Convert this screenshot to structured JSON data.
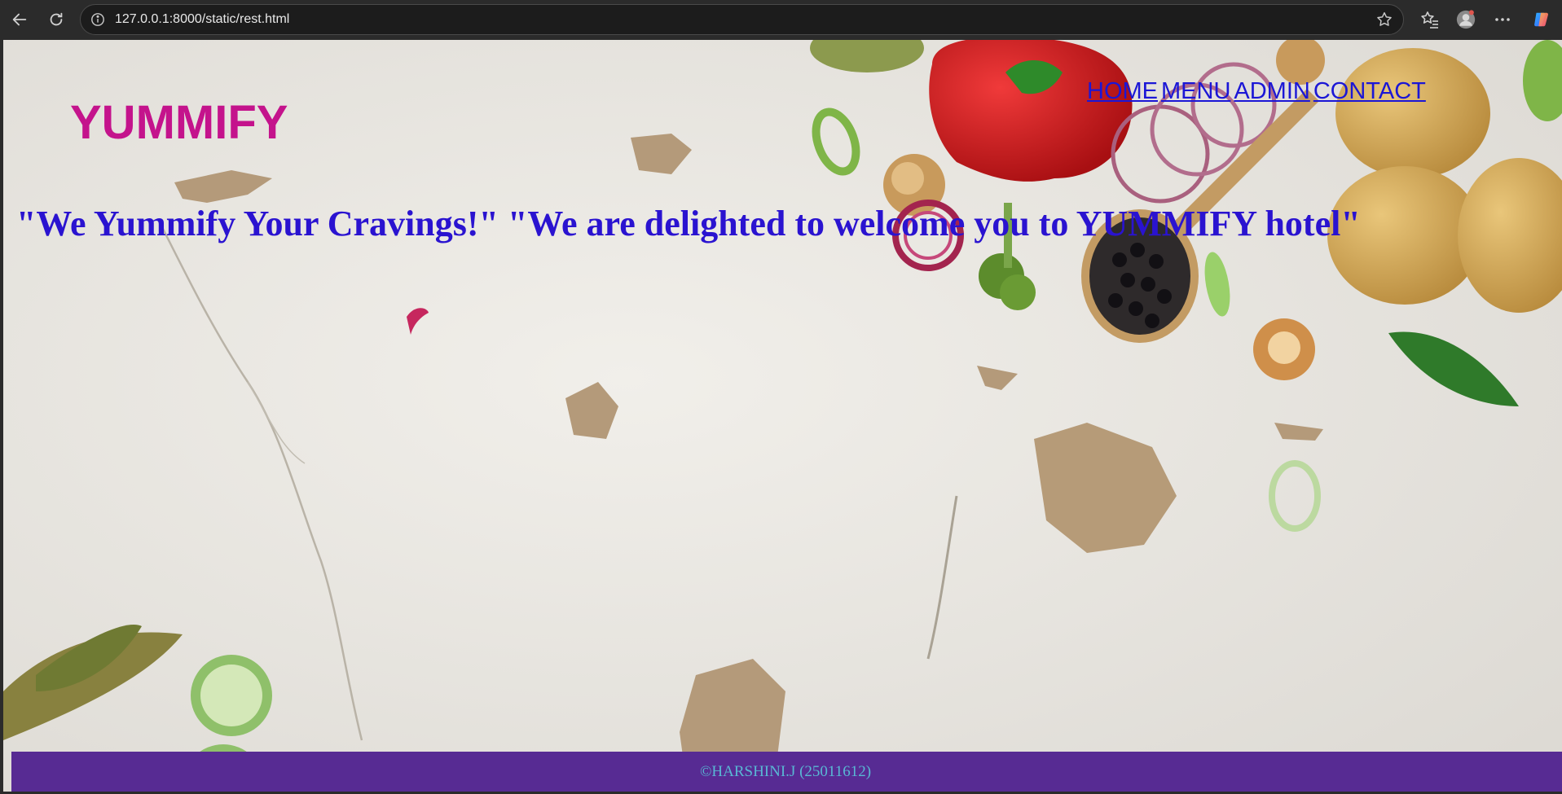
{
  "browser": {
    "url": "127.0.0.1:8000/static/rest.html",
    "icons": [
      "back-arrow-icon",
      "reload-icon",
      "site-info-icon",
      "favorite-star-icon",
      "favorites-icon",
      "profile-icon",
      "more-icon",
      "copilot-icon"
    ]
  },
  "page": {
    "brand": "YUMMIFY",
    "nav": [
      {
        "label": "HOME"
      },
      {
        "label": "MENU"
      },
      {
        "label": "ADMIN"
      },
      {
        "label": "CONTACT"
      }
    ],
    "hero": "\"We Yummify Your Cravings!\" \"We are delighted to welcome you to YUMMIFY hotel\"",
    "footer": "©HARSHINI.J (25011612)"
  },
  "colors": {
    "brand": "#c4138c",
    "nav_link": "#1b16d6",
    "hero": "#2a13d0",
    "footer_bg": "#572b93",
    "footer_text": "#58b8d4"
  }
}
